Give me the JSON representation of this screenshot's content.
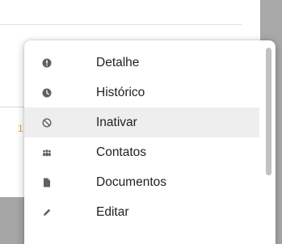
{
  "background": {
    "fragment_text": "1"
  },
  "menu": {
    "items": [
      {
        "label": "Detalhe",
        "icon": "info-circle-icon"
      },
      {
        "label": "Histórico",
        "icon": "clock-icon"
      },
      {
        "label": "Inativar",
        "icon": "ban-icon",
        "highlighted": true
      },
      {
        "label": "Contatos",
        "icon": "users-icon"
      },
      {
        "label": "Documentos",
        "icon": "file-icon"
      },
      {
        "label": "Editar",
        "icon": "pencil-icon"
      }
    ]
  },
  "colors": {
    "highlight": "#eeeeee",
    "text": "#222222",
    "icon": "#5f5f5f",
    "accent_fragment": "#e8a13a"
  }
}
